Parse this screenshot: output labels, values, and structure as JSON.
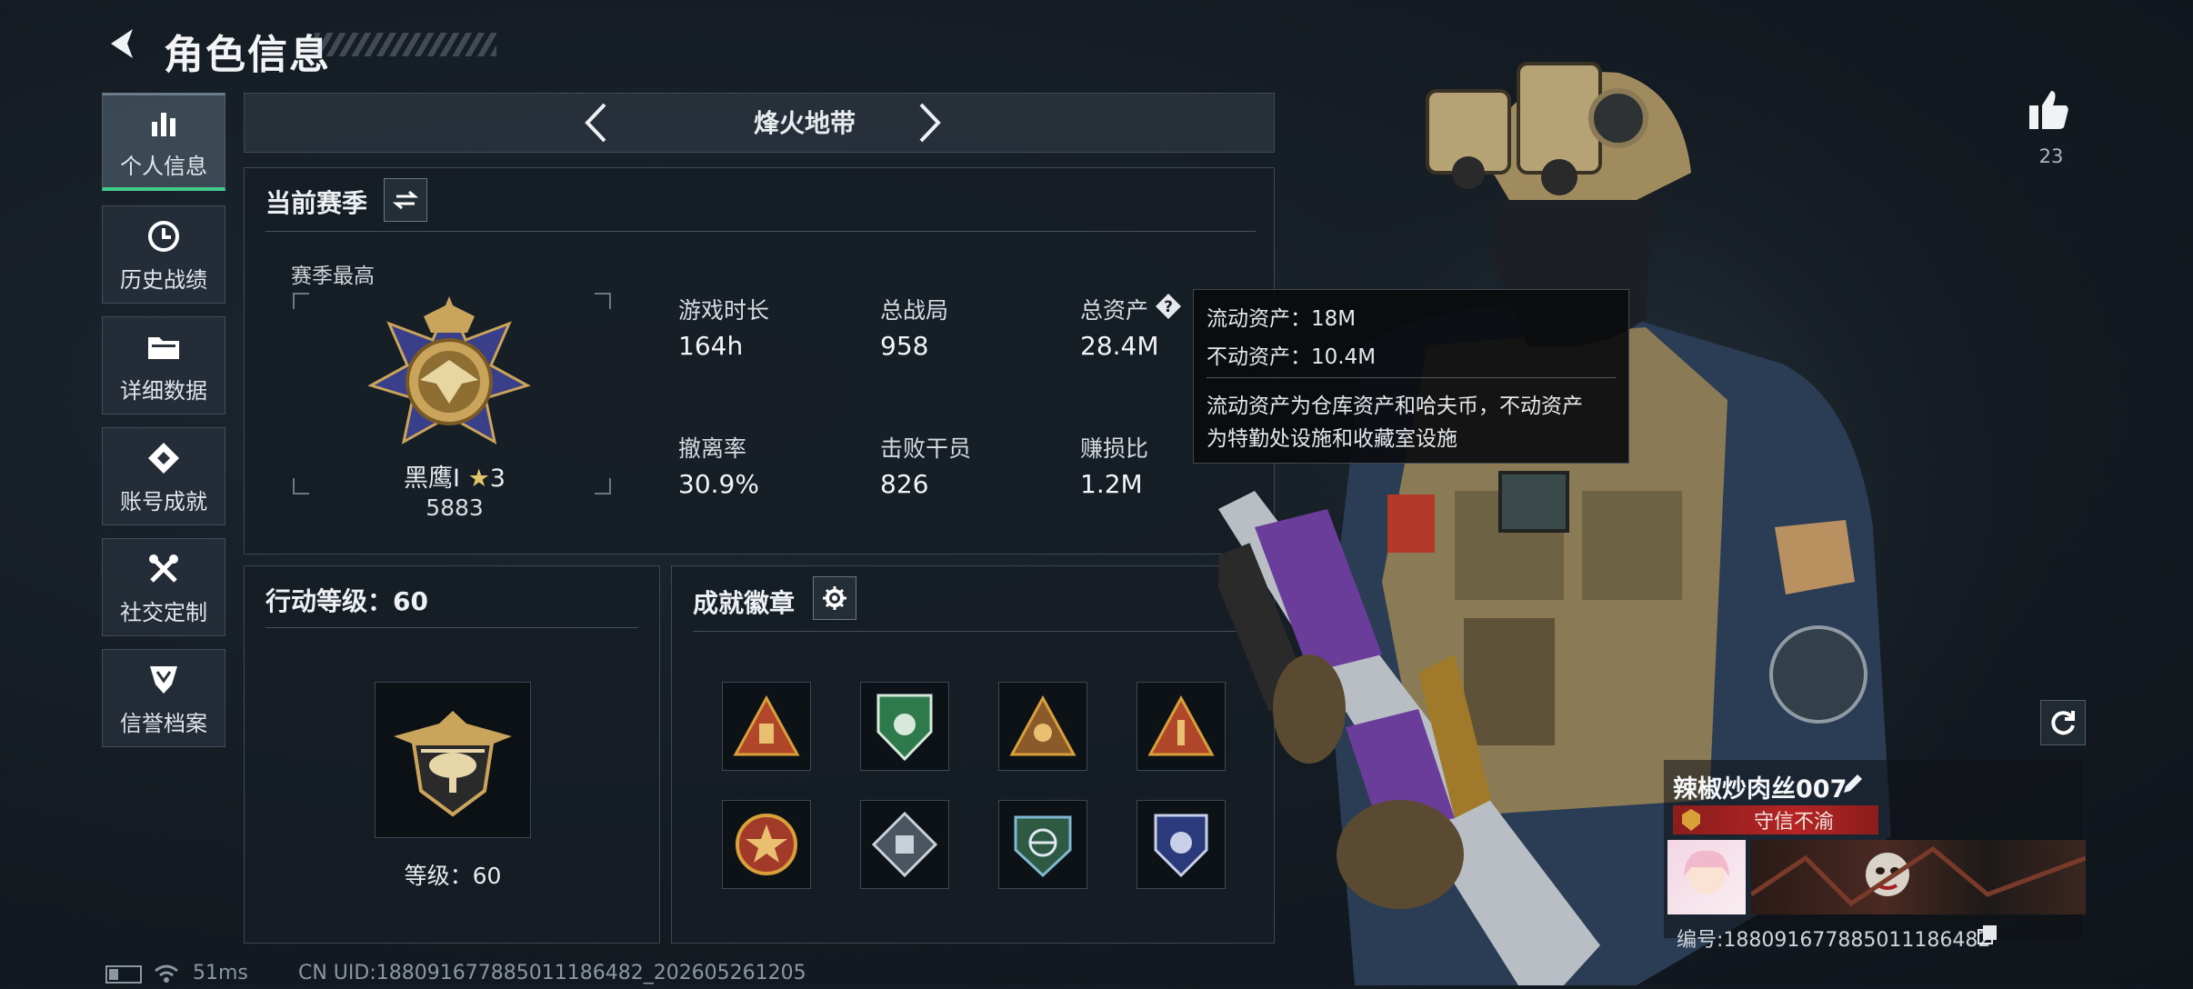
{
  "header": {
    "title": "角色信息"
  },
  "sidebar": {
    "items": [
      {
        "label": "个人信息",
        "icon": "bar-chart-icon",
        "active": true
      },
      {
        "label": "历史战绩",
        "icon": "history-clock-icon",
        "active": false
      },
      {
        "label": "详细数据",
        "icon": "folder-icon",
        "active": false
      },
      {
        "label": "账号成就",
        "icon": "achievement-diamond-icon",
        "active": false
      },
      {
        "label": "社交定制",
        "icon": "tools-icon",
        "active": false
      },
      {
        "label": "信誉档案",
        "icon": "shield-badge-icon",
        "active": false
      }
    ]
  },
  "mode_selector": {
    "label": "烽火地带"
  },
  "season": {
    "title": "当前赛季",
    "best_label": "赛季最高",
    "rank_name": "黑鹰Ⅰ",
    "rank_stars": "3",
    "rank_score": "5883",
    "stats": [
      {
        "label": "游戏时长",
        "value": "164h"
      },
      {
        "label": "总战局",
        "value": "958"
      },
      {
        "label": "总资产",
        "value": "28.4M"
      },
      {
        "label": "撤离率",
        "value": "30.9%"
      },
      {
        "label": "击败干员",
        "value": "826"
      },
      {
        "label": "赚损比",
        "value": "1.2M"
      }
    ]
  },
  "tooltip": {
    "liquid": "流动资产：18M",
    "fixed": "不动资产：10.4M",
    "desc_line1": "流动资产为仓库资产和哈夫币，不动资产",
    "desc_line2": "为特勤处设施和收藏室设施"
  },
  "action_level": {
    "title": "行动等级：60",
    "level_label": "等级：60"
  },
  "achievements": {
    "title": "成就徽章",
    "badges": [
      "badge-1",
      "badge-2",
      "badge-3",
      "badge-4",
      "badge-5",
      "badge-6",
      "badge-7",
      "badge-8"
    ]
  },
  "likes": {
    "count": "23"
  },
  "player": {
    "name": "辣椒炒肉丝007",
    "title_badge": "守信不渝",
    "uid": "编号:1880916778850111864​82"
  },
  "status_bar": {
    "latency": "51ms",
    "footer_uid": "CN UID:1880916778850111864​82_202605261205"
  },
  "colors": {
    "accent_green": "#3fc98a",
    "title_red": "#b52424",
    "gold": "#c9a45a"
  }
}
